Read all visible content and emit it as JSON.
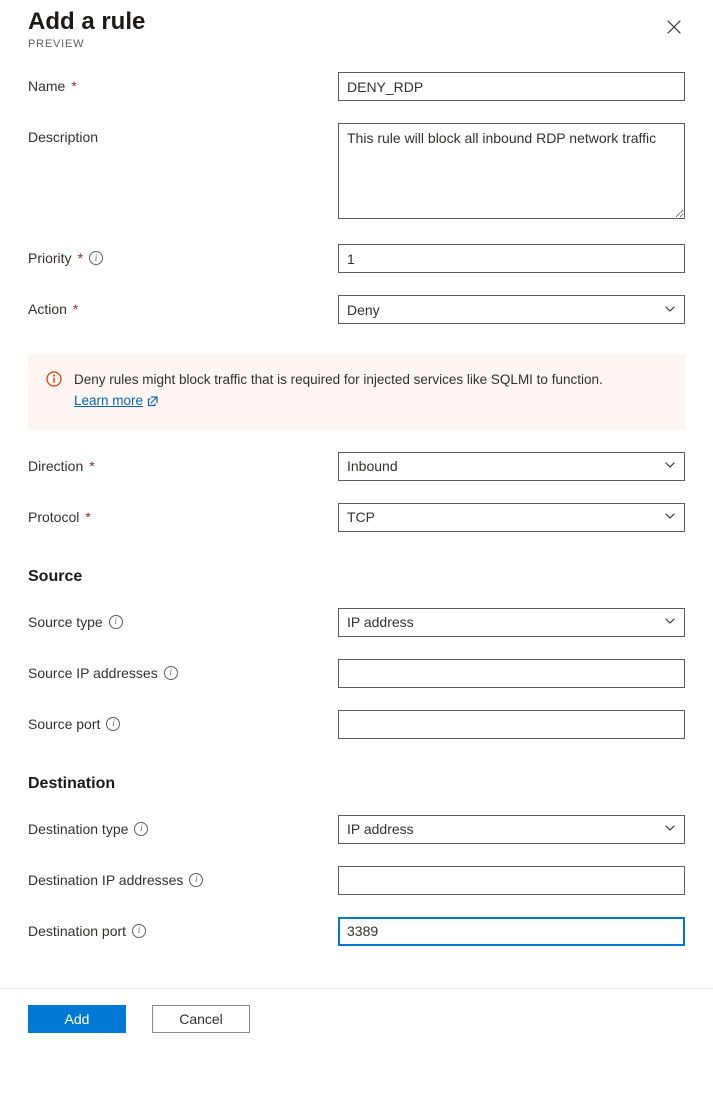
{
  "header": {
    "title": "Add a rule",
    "subtitle": "PREVIEW"
  },
  "fields": {
    "name": {
      "label": "Name",
      "value": "DENY_RDP"
    },
    "description": {
      "label": "Description",
      "value": "This rule will block all inbound RDP network traffic"
    },
    "priority": {
      "label": "Priority",
      "value": "1"
    },
    "action": {
      "label": "Action",
      "value": "Deny"
    },
    "direction": {
      "label": "Direction",
      "value": "Inbound"
    },
    "protocol": {
      "label": "Protocol",
      "value": "TCP"
    },
    "sourceType": {
      "label": "Source type",
      "value": "IP address"
    },
    "sourceIps": {
      "label": "Source IP addresses",
      "value": ""
    },
    "sourcePort": {
      "label": "Source port",
      "value": ""
    },
    "destType": {
      "label": "Destination type",
      "value": "IP address"
    },
    "destIps": {
      "label": "Destination IP addresses",
      "value": ""
    },
    "destPort": {
      "label": "Destination port",
      "value": "3389"
    }
  },
  "sections": {
    "source": "Source",
    "destination": "Destination"
  },
  "warning": {
    "text_prefix": "Deny rules might block traffic that is required for injected services like SQLMI to function. ",
    "link_text": "Learn more"
  },
  "footer": {
    "add": "Add",
    "cancel": "Cancel"
  },
  "required_glyph": "*"
}
